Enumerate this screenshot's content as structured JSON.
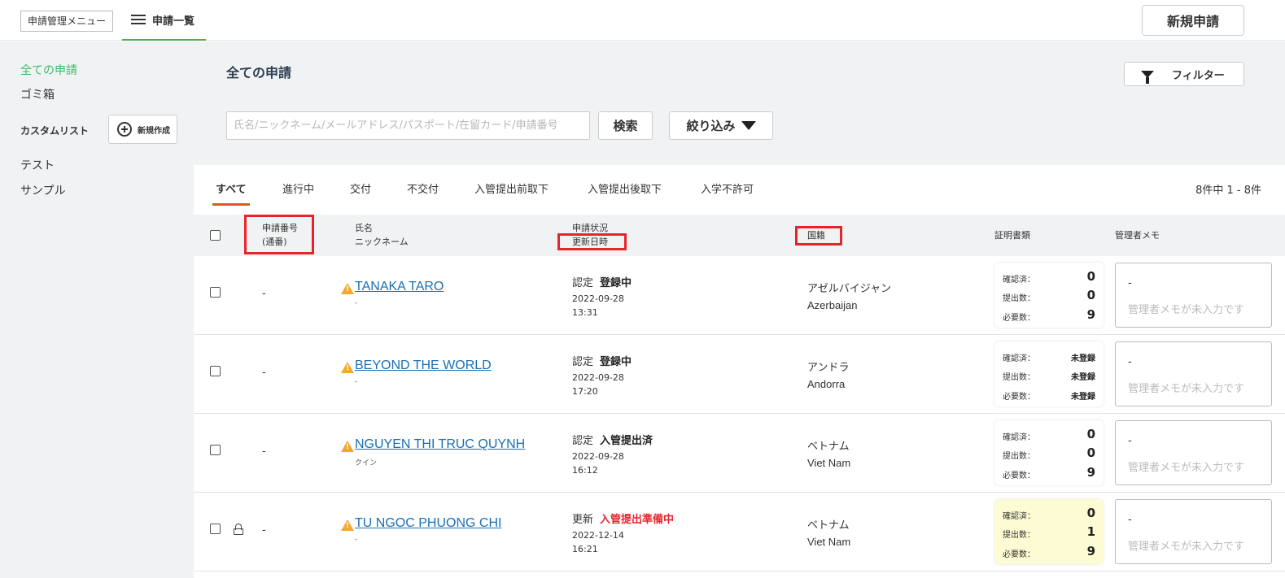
{
  "topbar": {
    "menu_label": "申請管理メニュー",
    "tab_label": "申請一覧",
    "new_application_label": "新規申請"
  },
  "sidebar": {
    "items": [
      {
        "label": "全ての申請",
        "active": true
      },
      {
        "label": "ゴミ箱"
      }
    ],
    "custom_list_label": "カスタムリスト",
    "new_create_label": "新規作成",
    "custom_items": [
      {
        "label": "テスト"
      },
      {
        "label": "サンプル"
      }
    ]
  },
  "main": {
    "page_title": "全ての申請",
    "filter_label": "フィルター",
    "search": {
      "placeholder": "氏名/ニックネーム/メールアドレス/パスポート/在留カード/申請番号",
      "value": ""
    },
    "search_button": "検索",
    "narrow_button": "絞り込み"
  },
  "status_tabs": {
    "tabs": [
      {
        "label": "すべて",
        "active": true
      },
      {
        "label": "進行中"
      },
      {
        "label": "交付"
      },
      {
        "label": "不交付"
      },
      {
        "label": "入管提出前取下"
      },
      {
        "label": "入管提出後取下"
      },
      {
        "label": "入学不許可"
      }
    ],
    "count_text": "8件中 1 -  8件"
  },
  "table": {
    "headers": {
      "app_no_1": "申請番号",
      "app_no_2": "(通番)",
      "name_1": "氏名",
      "name_2": "ニックネーム",
      "status_1": "申請状況",
      "status_2": "更新日時",
      "nationality": "国籍",
      "documents": "証明書類",
      "memo": "管理者メモ"
    },
    "doc_labels": {
      "confirmed": "確認済：",
      "submitted": "提出数：",
      "required": "必要数："
    },
    "memo_placeholder": "管理者メモが未入力です",
    "rows": [
      {
        "app_no": "-",
        "name": "TANAKA TARO",
        "nickname": "-",
        "status_type": "認定",
        "status": "登録中",
        "date": "2022-09-28",
        "time": "13:31",
        "nationality_ja": "アゼルバイジャン",
        "nationality_en": "Azerbaijan",
        "confirmed": "0",
        "submitted": "0",
        "required": "9",
        "memo": "-"
      },
      {
        "app_no": "-",
        "name": "BEYOND THE WORLD",
        "nickname": "-",
        "status_type": "認定",
        "status": "登録中",
        "date": "2022-09-28",
        "time": "17:20",
        "nationality_ja": "アンドラ",
        "nationality_en": "Andorra",
        "confirmed": "未登録",
        "submitted": "未登録",
        "required": "未登録",
        "memo": "-"
      },
      {
        "app_no": "-",
        "name": "NGUYEN THI TRUC QUYNH",
        "nickname": "クイン",
        "status_type": "認定",
        "status": "入管提出済",
        "date": "2022-09-28",
        "time": "16:12",
        "nationality_ja": "ベトナム",
        "nationality_en": "Viet Nam",
        "confirmed": "0",
        "submitted": "0",
        "required": "9",
        "memo": "-"
      },
      {
        "app_no": "-",
        "name": "TU NGOC PHUONG CHI",
        "nickname": "-",
        "status_type": "更新",
        "status": "入管提出準備中",
        "date": "2022-12-14",
        "time": "16:21",
        "nationality_ja": "ベトナム",
        "nationality_en": "Viet Nam",
        "confirmed": "0",
        "submitted": "1",
        "required": "9",
        "memo": "-"
      }
    ]
  },
  "colors": {
    "accent_green": "#3cba6a",
    "tab_underline": "#e8541f",
    "highlight_red": "#e8242b",
    "link_blue": "#1a6fb5",
    "warning": "#f0a830",
    "doc_highlight": "#fdfbd3"
  }
}
